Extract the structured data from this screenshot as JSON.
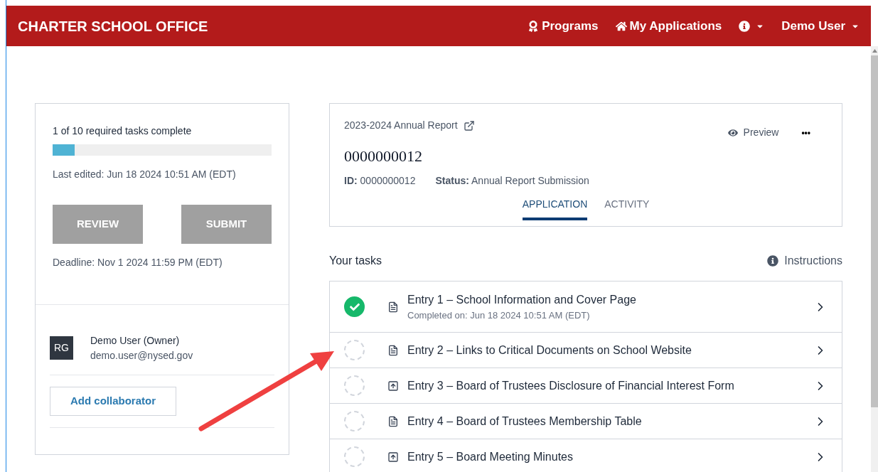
{
  "header": {
    "brand": "CHARTER SCHOOL OFFICE",
    "nav": [
      {
        "kind": "programs",
        "label": "Programs"
      },
      {
        "kind": "home",
        "label": "My Applications"
      },
      {
        "kind": "info"
      },
      {
        "kind": "user",
        "label": "Demo User"
      }
    ]
  },
  "summary": {
    "progress_text": "1 of 10 required tasks complete",
    "level": 0.1,
    "last_edited": "Last edited: Jun 18 2024 10:51 AM (EDT)",
    "buttons": [
      {
        "label": "REVIEW",
        "disabled": true
      },
      {
        "label": "SUBMIT",
        "disabled": true
      }
    ],
    "deadline": "Deadline: Nov 1 2024 11:59 PM (EDT)"
  },
  "collaborators": [
    {
      "initials": "RG",
      "name": "Demo User (Owner)",
      "email": "demo.user@nysed.gov"
    }
  ],
  "add_collaborator": "Add collaborator",
  "application": {
    "report": "2023-2024 Annual Report",
    "number": "0000000012",
    "id_label": "ID:",
    "id": "0000000012",
    "status_label": "Status:",
    "status": "Annual Report Submission",
    "preview": "Preview",
    "more": "•••",
    "tabs": [
      {
        "label": "APPLICATION",
        "selected": true
      },
      {
        "label": "ACTIVITY",
        "selected": false
      }
    ]
  },
  "tasks_title": "Your tasks",
  "instructions": "Instructions",
  "tasks": [
    {
      "title": "Entry 1 – School Information and Cover Page",
      "kind": "document",
      "completed": true,
      "note": "Completed on: Jun 18 2024 10:51 AM (EDT)"
    },
    {
      "title": "Entry 2 – Links to Critical Documents on School Website",
      "kind": "document",
      "completed": false
    },
    {
      "title": "Entry 3 – Board of Trustees Disclosure of Financial Interest Form",
      "kind": "upload",
      "completed": false
    },
    {
      "title": "Entry 4 – Board of Trustees Membership Table",
      "kind": "document",
      "completed": false
    },
    {
      "title": "Entry 5 – Board Meeting Minutes",
      "kind": "upload",
      "completed": false
    }
  ]
}
